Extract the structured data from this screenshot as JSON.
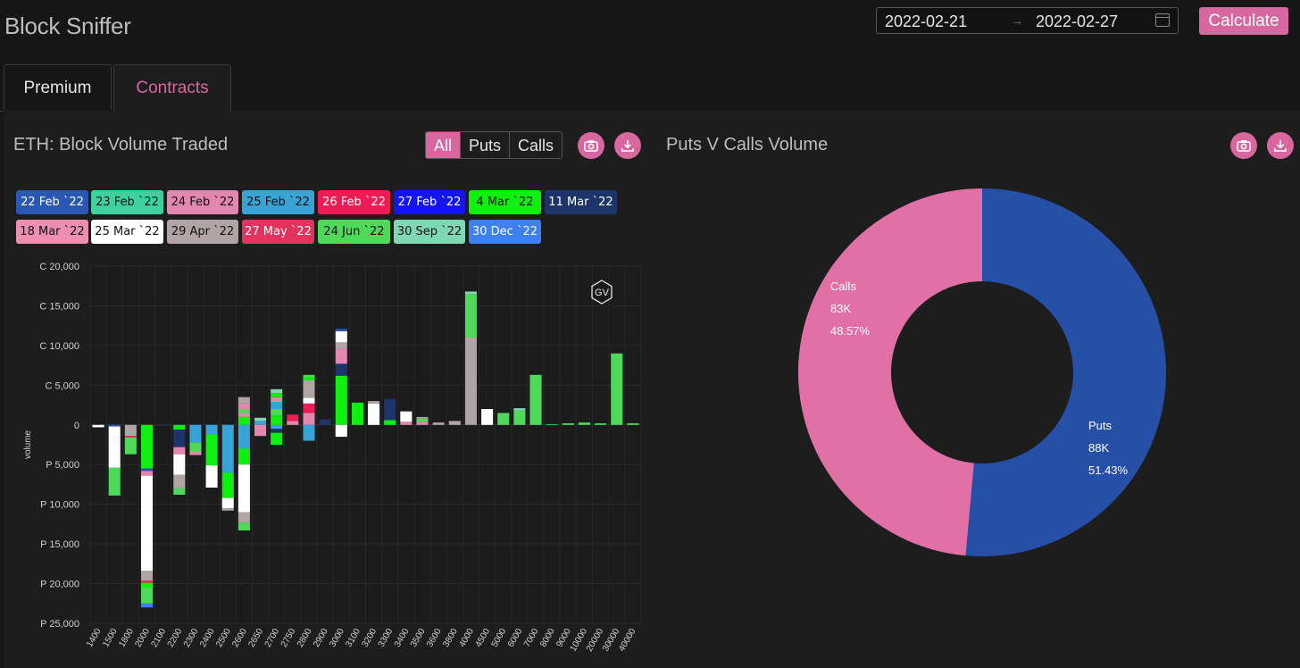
{
  "app": {
    "title": "Block Sniffer"
  },
  "date_range": {
    "start": "2022-02-21",
    "end": "2022-02-27",
    "separator": "→"
  },
  "calculate_label": "Calculate",
  "tabs": [
    {
      "label": "Premium",
      "active": false
    },
    {
      "label": "Contracts",
      "active": true
    }
  ],
  "left_panel": {
    "title": "ETH: Block Volume Traded",
    "filters": [
      {
        "label": "All",
        "active": true
      },
      {
        "label": "Puts",
        "active": false
      },
      {
        "label": "Calls",
        "active": false
      }
    ],
    "icons": [
      "camera-icon",
      "download-icon"
    ]
  },
  "right_panel": {
    "title": "Puts V Calls Volume",
    "icons": [
      "camera-icon",
      "download-icon"
    ]
  },
  "watermark": "GV",
  "colors": {
    "accent": "#d9679f",
    "puts": "#2650a8",
    "calls": "#e070a6"
  },
  "legend": [
    {
      "label": "22 Feb `22",
      "color": "#2a56b4",
      "text": "#ffffff"
    },
    {
      "label": "23 Feb `22",
      "color": "#3fd0a0",
      "text": "#111111"
    },
    {
      "label": "24 Feb `22",
      "color": "#e387b1",
      "text": "#111111"
    },
    {
      "label": "25 Feb `22",
      "color": "#38a3d6",
      "text": "#111111"
    },
    {
      "label": "26 Feb `22",
      "color": "#ee1b55",
      "text": "#ffffff"
    },
    {
      "label": "27 Feb `22",
      "color": "#1414f0",
      "text": "#ffffff"
    },
    {
      "label": "4 Mar `22",
      "color": "#10f010",
      "text": "#111111"
    },
    {
      "label": "11 Mar `22",
      "color": "#1c3468",
      "text": "#ffffff"
    },
    {
      "label": "18 Mar `22",
      "color": "#ec8eaf",
      "text": "#111111"
    },
    {
      "label": "25 Mar `22",
      "color": "#ffffff",
      "text": "#111111"
    },
    {
      "label": "29 Apr `22",
      "color": "#b0a4a4",
      "text": "#111111"
    },
    {
      "label": "27 May `22",
      "color": "#e2335e",
      "text": "#ffffff"
    },
    {
      "label": "24 Jun `22",
      "color": "#4ed95a",
      "text": "#111111"
    },
    {
      "label": "30 Sep `22",
      "color": "#7fd8b4",
      "text": "#111111"
    },
    {
      "label": "30 Dec `22",
      "color": "#3d80ee",
      "text": "#ffffff"
    }
  ],
  "chart_data": [
    {
      "type": "bar",
      "stacked": true,
      "ylabel": "volume",
      "ylim": [
        -25000,
        20000
      ],
      "y_ticks": [
        {
          "v": 20000,
          "label": "C 20,000"
        },
        {
          "v": 15000,
          "label": "C 15,000"
        },
        {
          "v": 10000,
          "label": "C 10,000"
        },
        {
          "v": 5000,
          "label": "C 5,000"
        },
        {
          "v": 0,
          "label": "0"
        },
        {
          "v": -5000,
          "label": "P 5,000"
        },
        {
          "v": -10000,
          "label": "P 10,000"
        },
        {
          "v": -15000,
          "label": "P 15,000"
        },
        {
          "v": -20000,
          "label": "P 20,000"
        },
        {
          "v": -25000,
          "label": "P 25,000"
        }
      ],
      "categories": [
        "1400",
        "1500",
        "1800",
        "2000",
        "2100",
        "2200",
        "2300",
        "2400",
        "2500",
        "2600",
        "2650",
        "2700",
        "2750",
        "2800",
        "2900",
        "3000",
        "3100",
        "3200",
        "3300",
        "3400",
        "3500",
        "3600",
        "3800",
        "4000",
        "4500",
        "5000",
        "6000",
        "7000",
        "8000",
        "9000",
        "10000",
        "20000",
        "30000",
        "40000"
      ],
      "bars": [
        {
          "c": [],
          "p": [
            [
              "25 Mar `22",
              300
            ]
          ]
        },
        {
          "c": [],
          "p": [
            [
              "22 Feb `22",
              200
            ],
            [
              "25 Mar `22",
              5200
            ],
            [
              "24 Jun `22",
              3500
            ]
          ]
        },
        {
          "c": [],
          "p": [
            [
              "29 Apr `22",
              1400
            ],
            [
              "27 May `22",
              200
            ],
            [
              "24 Jun `22",
              2100
            ]
          ]
        },
        {
          "c": [],
          "p": [
            [
              "4 Mar `22",
              5500
            ],
            [
              "22 Feb `22",
              300
            ],
            [
              "24 Feb `22",
              600
            ],
            [
              "25 Mar `22",
              12000
            ],
            [
              "29 Apr `22",
              1200
            ],
            [
              "27 May `22",
              300
            ],
            [
              "4 Mar `22",
              600
            ],
            [
              "24 Jun `22",
              2000
            ],
            [
              "30 Dec `22",
              500
            ]
          ]
        },
        {
          "c": [],
          "p": [
            [
              "11 Mar `22",
              100
            ]
          ]
        },
        {
          "c": [],
          "p": [
            [
              "4 Mar `22",
              600
            ],
            [
              "11 Mar `22",
              2200
            ],
            [
              "24 Feb `22",
              900
            ],
            [
              "25 Mar `22",
              2600
            ],
            [
              "29 Apr `22",
              1700
            ],
            [
              "24 Jun `22",
              800
            ]
          ]
        },
        {
          "c": [],
          "p": [
            [
              "25 Feb `22",
              2200
            ],
            [
              "24 Jun `22",
              1200
            ],
            [
              "24 Feb `22",
              400
            ]
          ]
        },
        {
          "c": [],
          "p": [
            [
              "25 Feb `22",
              1200
            ],
            [
              "4 Mar `22",
              3900
            ],
            [
              "25 Mar `22",
              2800
            ]
          ]
        },
        {
          "c": [],
          "p": [
            [
              "25 Feb `22",
              6000
            ],
            [
              "4 Mar `22",
              3200
            ],
            [
              "25 Mar `22",
              1300
            ],
            [
              "29 Apr `22",
              300
            ]
          ]
        },
        {
          "c": [
            [
              "4 Mar `22",
              1000
            ],
            [
              "24 Feb `22",
              500
            ],
            [
              "24 Jun `22",
              500
            ],
            [
              "24 Feb `22",
              700
            ],
            [
              "29 Apr `22",
              800
            ]
          ],
          "p": [
            [
              "25 Feb `22",
              3000
            ],
            [
              "4 Mar `22",
              2000
            ],
            [
              "25 Mar `22",
              6000
            ],
            [
              "29 Apr `22",
              1300
            ],
            [
              "24 Jun `22",
              1000
            ]
          ]
        },
        {
          "c": [
            [
              "25 Feb `22",
              500
            ],
            [
              "30 Sep `22",
              400
            ]
          ],
          "p": [
            [
              "24 Feb `22",
              1400
            ]
          ]
        },
        {
          "c": [
            [
              "4 Mar `22",
              1200
            ],
            [
              "24 Jun `22",
              800
            ],
            [
              "25 Feb `22",
              900
            ],
            [
              "24 Feb `22",
              600
            ],
            [
              "4 Mar `22",
              500
            ],
            [
              "30 Sep `22",
              500
            ]
          ],
          "p": [
            [
              "25 Feb `22",
              500
            ],
            [
              "11 Mar `22",
              500
            ],
            [
              "4 Mar `22",
              1500
            ]
          ]
        },
        {
          "c": [
            [
              "24 Feb `22",
              500
            ],
            [
              "26 Feb `22",
              800
            ]
          ],
          "p": []
        },
        {
          "c": [
            [
              "24 Feb `22",
              1500
            ],
            [
              "26 Feb `22",
              1200
            ],
            [
              "25 Mar `22",
              700
            ],
            [
              "29 Apr `22",
              2200
            ],
            [
              "4 Mar `22",
              400
            ],
            [
              "24 Jun `22",
              300
            ]
          ],
          "p": [
            [
              "25 Feb `22",
              2000
            ]
          ]
        },
        {
          "c": [
            [
              "11 Mar `22",
              700
            ]
          ],
          "p": []
        },
        {
          "c": [
            [
              "4 Mar `22",
              6200
            ],
            [
              "11 Mar `22",
              1500
            ],
            [
              "24 Feb `22",
              1900
            ],
            [
              "29 Apr `22",
              800
            ],
            [
              "25 Mar `22",
              1400
            ],
            [
              "22 Feb `22",
              300
            ]
          ],
          "p": [
            [
              "25 Mar `22",
              1500
            ]
          ]
        },
        {
          "c": [
            [
              "4 Mar `22",
              2800
            ]
          ],
          "p": []
        },
        {
          "c": [
            [
              "25 Mar `22",
              2700
            ],
            [
              "29 Apr `22",
              300
            ]
          ],
          "p": []
        },
        {
          "c": [
            [
              "4 Mar `22",
              600
            ],
            [
              "11 Mar `22",
              2700
            ]
          ],
          "p": []
        },
        {
          "c": [
            [
              "24 Feb `22",
              400
            ],
            [
              "25 Mar `22",
              1300
            ]
          ],
          "p": []
        },
        {
          "c": [
            [
              "24 Feb `22",
              400
            ],
            [
              "24 Jun `22",
              400
            ],
            [
              "29 Apr `22",
              200
            ]
          ],
          "p": []
        },
        {
          "c": [
            [
              "29 Apr `22",
              300
            ]
          ],
          "p": []
        },
        {
          "c": [
            [
              "29 Apr `22",
              500
            ]
          ],
          "p": []
        },
        {
          "c": [
            [
              "29 Apr `22",
              11000
            ],
            [
              "24 Jun `22",
              5500
            ],
            [
              "30 Sep `22",
              300
            ]
          ],
          "p": []
        },
        {
          "c": [
            [
              "25 Mar `22",
              2000
            ]
          ],
          "p": []
        },
        {
          "c": [
            [
              "24 Jun `22",
              1500
            ]
          ],
          "p": []
        },
        {
          "c": [
            [
              "24 Jun `22",
              1800
            ],
            [
              "30 Sep `22",
              300
            ]
          ],
          "p": []
        },
        {
          "c": [
            [
              "24 Jun `22",
              6300
            ]
          ],
          "p": []
        },
        {
          "c": [
            [
              "24 Jun `22",
              100
            ]
          ],
          "p": []
        },
        {
          "c": [
            [
              "24 Jun `22",
              200
            ]
          ],
          "p": []
        },
        {
          "c": [
            [
              "24 Jun `22",
              300
            ]
          ],
          "p": []
        },
        {
          "c": [
            [
              "24 Jun `22",
              200
            ]
          ],
          "p": []
        },
        {
          "c": [
            [
              "24 Jun `22",
              9000
            ]
          ],
          "p": []
        },
        {
          "c": [
            [
              "24 Jun `22",
              200
            ]
          ],
          "p": []
        }
      ]
    },
    {
      "type": "pie",
      "donut": true,
      "slices": [
        {
          "label": "Puts",
          "value_label": "88K",
          "pct_label": "51.43%",
          "value": 51.43,
          "color": "#2650a8"
        },
        {
          "label": "Calls",
          "value_label": "83K",
          "pct_label": "48.57%",
          "value": 48.57,
          "color": "#e070a6"
        }
      ]
    }
  ]
}
